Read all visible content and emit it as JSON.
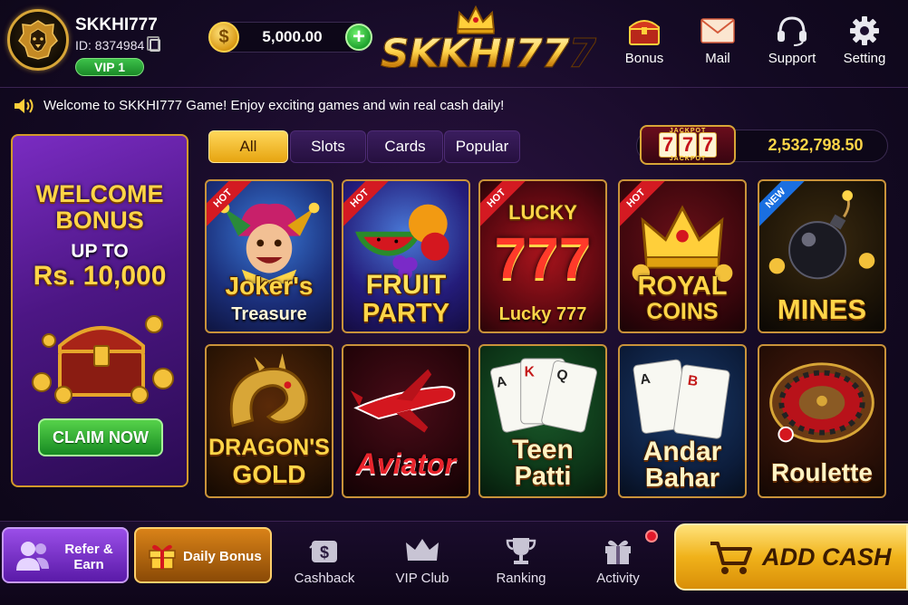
{
  "user": {
    "username": "SKKHI777",
    "id_text": "ID: 8374984",
    "vip": "VIP 1",
    "balance": "5,000.00"
  },
  "brand": {
    "logo": "SKKHI777"
  },
  "top_nav": [
    {
      "label": "Bonus",
      "icon": "treasure-chest-icon"
    },
    {
      "label": "Mail",
      "icon": "envelope-icon"
    },
    {
      "label": "Support",
      "icon": "headset-icon"
    },
    {
      "label": "Setting",
      "icon": "gear-icon"
    }
  ],
  "marquee": {
    "text": "Welcome to SKKHI777 Game! Enjoy exciting games and win real cash daily!"
  },
  "promo": {
    "title_line1": "WELCOME",
    "title_line2": "BONUS",
    "upto": "UP TO",
    "amount": "Rs. 10,000",
    "cta": "CLAIM NOW"
  },
  "tabs": [
    {
      "label": "All",
      "active": true
    },
    {
      "label": "Slots",
      "active": false
    },
    {
      "label": "Cards",
      "active": false
    },
    {
      "label": "Popular",
      "active": false
    }
  ],
  "jackpot": {
    "digits": [
      "7",
      "7",
      "7"
    ],
    "word": "JACKPOT",
    "value": "2,532,798.50"
  },
  "games": [
    {
      "title": "Joker's",
      "subtitle": "Treasure",
      "badge": "HOT"
    },
    {
      "title": "FRUIT",
      "subtitle": "PARTY",
      "badge": "HOT"
    },
    {
      "title": "LUCKY",
      "subtitle": "Lucky 777",
      "reels": "777",
      "badge": "HOT"
    },
    {
      "title": "ROYAL",
      "subtitle": "COINS",
      "badge": "HOT"
    },
    {
      "title": "MINES",
      "subtitle": "",
      "badge": "NEW"
    },
    {
      "title": "DRAGON'S",
      "subtitle": "GOLD",
      "badge": ""
    },
    {
      "title": "Aviator",
      "subtitle": "",
      "badge": ""
    },
    {
      "title": "Teen",
      "subtitle": "Patti",
      "badge": ""
    },
    {
      "title": "Andar",
      "subtitle": "Bahar",
      "badge": ""
    },
    {
      "title": "Roulette",
      "subtitle": "",
      "badge": ""
    }
  ],
  "bottom_bar": {
    "refer_label": "Refer & Earn",
    "daily_bonus_label": "Daily Bonus",
    "nav": [
      {
        "label": "Cashback",
        "icon": "cashback-icon"
      },
      {
        "label": "VIP Club",
        "icon": "crown-icon"
      },
      {
        "label": "Ranking",
        "icon": "trophy-icon"
      },
      {
        "label": "Activity",
        "icon": "gift-icon"
      }
    ],
    "add_cash_label": "ADD CASH"
  },
  "colors": {
    "gold": "#ffd548",
    "accent_green": "#1a8a27",
    "purple": "#4c1684",
    "background": "#140a24"
  }
}
